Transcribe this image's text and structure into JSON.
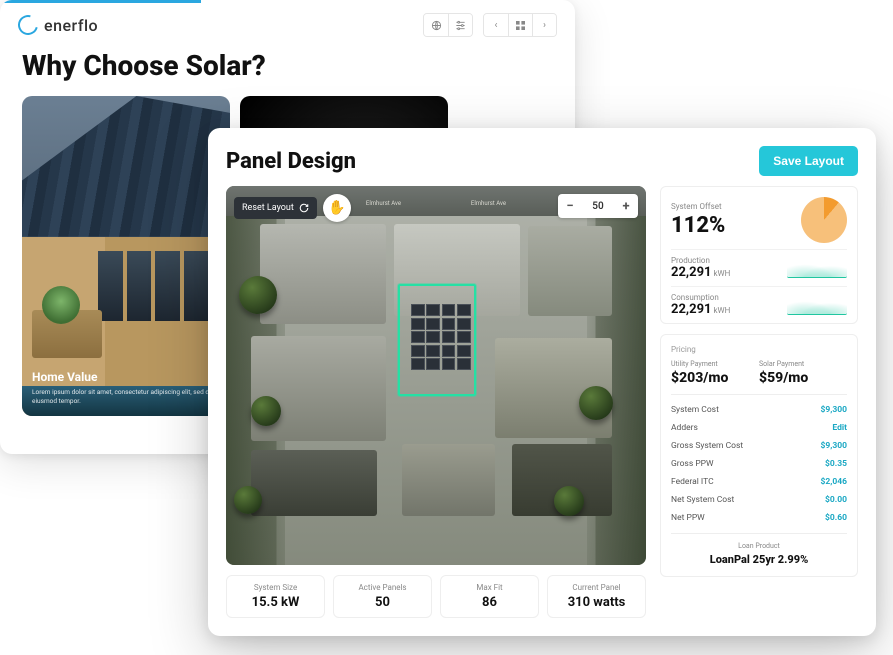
{
  "back": {
    "brand": "enerflo",
    "title": "Why Choose Solar?",
    "card1": {
      "title": "Home Value",
      "sub": "Lorem ipsum dolor sit amet, consectetur adipiscing elit, sed do eiusmod tempor."
    }
  },
  "front": {
    "title": "Panel Design",
    "save": "Save Layout",
    "reset": "Reset Layout",
    "road_label": "Elmhurst Ave",
    "zoom": {
      "minus": "−",
      "value": "50",
      "plus": "+"
    },
    "stats": [
      {
        "label": "System Size",
        "value": "15.5 kW"
      },
      {
        "label": "Active Panels",
        "value": "50"
      },
      {
        "label": "Max Fit",
        "value": "86"
      },
      {
        "label": "Current Panel",
        "value": "310 watts"
      }
    ],
    "metrics": {
      "offset_label": "System Offset",
      "offset_value": "112%",
      "production_label": "Production",
      "production_value": "22,291",
      "production_unit": "kWH",
      "consumption_label": "Consumption",
      "consumption_value": "22,291",
      "consumption_unit": "kWH"
    },
    "pricing": {
      "title": "Pricing",
      "utility_label": "Utility Payment",
      "utility_value": "$203/mo",
      "solar_label": "Solar Payment",
      "solar_value": "$59/mo",
      "lines": [
        {
          "label": "System Cost",
          "value": "$9,300"
        },
        {
          "label": "Adders",
          "value": "Edit"
        },
        {
          "label": "Gross System Cost",
          "value": "$9,300"
        },
        {
          "label": "Gross PPW",
          "value": "$0.35"
        },
        {
          "label": "Federal ITC",
          "value": "$2,046"
        },
        {
          "label": "Net System Cost",
          "value": "$0.00"
        },
        {
          "label": "Net PPW",
          "value": "$0.60"
        }
      ],
      "loan_label": "Loan Product",
      "loan_value": "LoanPal 25yr 2.99%"
    }
  },
  "chart_data": {
    "type": "pie",
    "title": "System Offset",
    "values": [
      112
    ],
    "unit": "%"
  }
}
